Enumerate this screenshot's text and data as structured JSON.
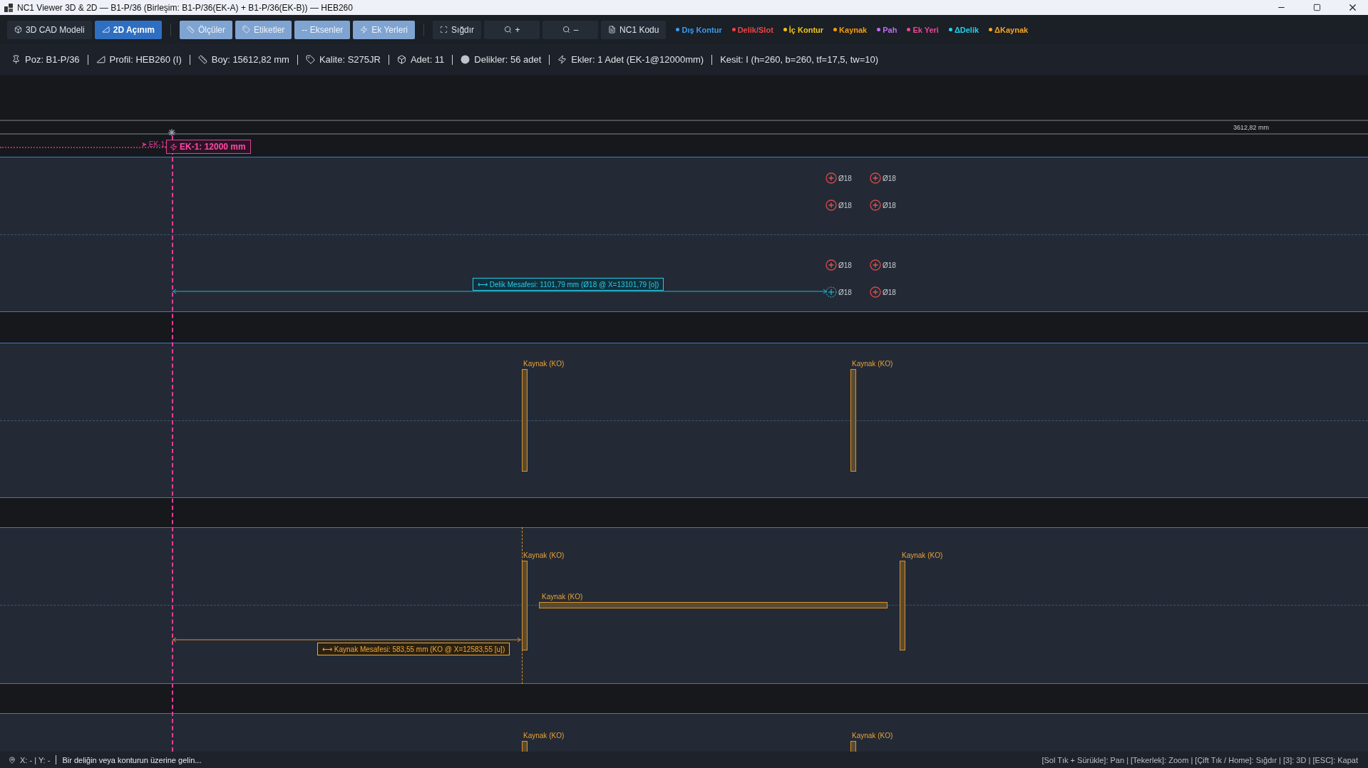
{
  "window": {
    "title": "NC1 Viewer 3D & 2D — B1-P/36 (Birleşim: B1-P/36(EK-A) + B1-P/36(EK-B)) — HEB260"
  },
  "toolbar": {
    "views": [
      {
        "label": "3D CAD Modeli",
        "kind": "cube",
        "selected": false
      },
      {
        "label": "2D Açınım",
        "kind": "square",
        "selected": true
      }
    ],
    "overlays": [
      {
        "label": "Ölçüler",
        "kind": "ruler",
        "on": true
      },
      {
        "label": "Etiketler",
        "kind": "tag",
        "on": true
      },
      {
        "label": "-- Eksenler",
        "kind": "plain",
        "on": true
      },
      {
        "label": "Ek Yerleri",
        "kind": "bolt",
        "on": true
      }
    ],
    "tools": [
      {
        "label": "Sığdır",
        "kind": "fit"
      },
      {
        "label": "+",
        "kind": "zoom"
      },
      {
        "label": "–",
        "kind": "zoom"
      },
      {
        "label": "NC1 Kodu",
        "kind": "file"
      }
    ],
    "legend": [
      {
        "label": "Dış Kontur",
        "color": "#3b9cf0"
      },
      {
        "label": "Delik/Slot",
        "color": "#ef4444"
      },
      {
        "label": "İç Kontur",
        "color": "#f5c518"
      },
      {
        "label": "Kaynak",
        "color": "#f59e0b"
      },
      {
        "label": "Pah",
        "color": "#c06cf0"
      },
      {
        "label": "Ek Yeri",
        "color": "#ec4899"
      },
      {
        "label": "ΔDelik",
        "color": "#22d3ee"
      },
      {
        "label": "ΔKaynak",
        "color": "#f5a524"
      }
    ]
  },
  "info": [
    {
      "kind": "pin",
      "text": "Poz: B1-P/36"
    },
    {
      "kind": "square",
      "text": "Profil: HEB260 (I)"
    },
    {
      "kind": "ruler",
      "text": "Boy: 15612,82 mm"
    },
    {
      "kind": "tag",
      "text": "Kalite: S275JR"
    },
    {
      "kind": "cube",
      "text": "Adet: 11"
    },
    {
      "kind": "hole",
      "text": "Delikler: 56 adet"
    },
    {
      "kind": "bolt",
      "text": "Ekler: 1 Adet (EK-1@12000mm)"
    },
    {
      "kind": "plain",
      "text": "Kesit: I (h=260, b=260, tf=17,5, tw=10)"
    }
  ],
  "canvas": {
    "length_label": "3612,82 mm",
    "splice": {
      "marker": "➤ EK-1:",
      "label": "EK-1: 12000 mm"
    },
    "holes": [
      {
        "label": "Ø18",
        "selected": false
      },
      {
        "label": "Ø18",
        "selected": false
      },
      {
        "label": "Ø18",
        "selected": false
      },
      {
        "label": "Ø18",
        "selected": false
      },
      {
        "label": "Ø18",
        "selected": false
      },
      {
        "label": "Ø18",
        "selected": false
      },
      {
        "label": "Ø18",
        "selected": true
      },
      {
        "label": "Ø18",
        "selected": false
      }
    ],
    "hole_distance": "⟷ Delik Mesafesi: 1101,79 mm (Ø18 @ X=13101,79 [o])",
    "welds": [
      {
        "label": "Kaynak (KO)"
      },
      {
        "label": "Kaynak (KO)"
      },
      {
        "label": "Kaynak (KO)"
      },
      {
        "label": "Kaynak (KO)"
      },
      {
        "label": "Kaynak (KO)"
      },
      {
        "label": "Kaynak (KO)"
      },
      {
        "label": "Kaynak (KO)"
      }
    ],
    "weld_distance": "⟷ Kaynak Mesafesi: 583,55 mm (KO @ X=12583,55 [u])"
  },
  "status_bar": {
    "coords": "X: - | Y: -",
    "message": "Bir deliğin veya konturun üzerine gelin...",
    "hints": "[Sol Tık + Sürükle]: Pan | [Tekerlek]: Zoom | [Çift Tık / Home]: Sığdır | [3]: 3D | [ESC]: Kapat"
  }
}
